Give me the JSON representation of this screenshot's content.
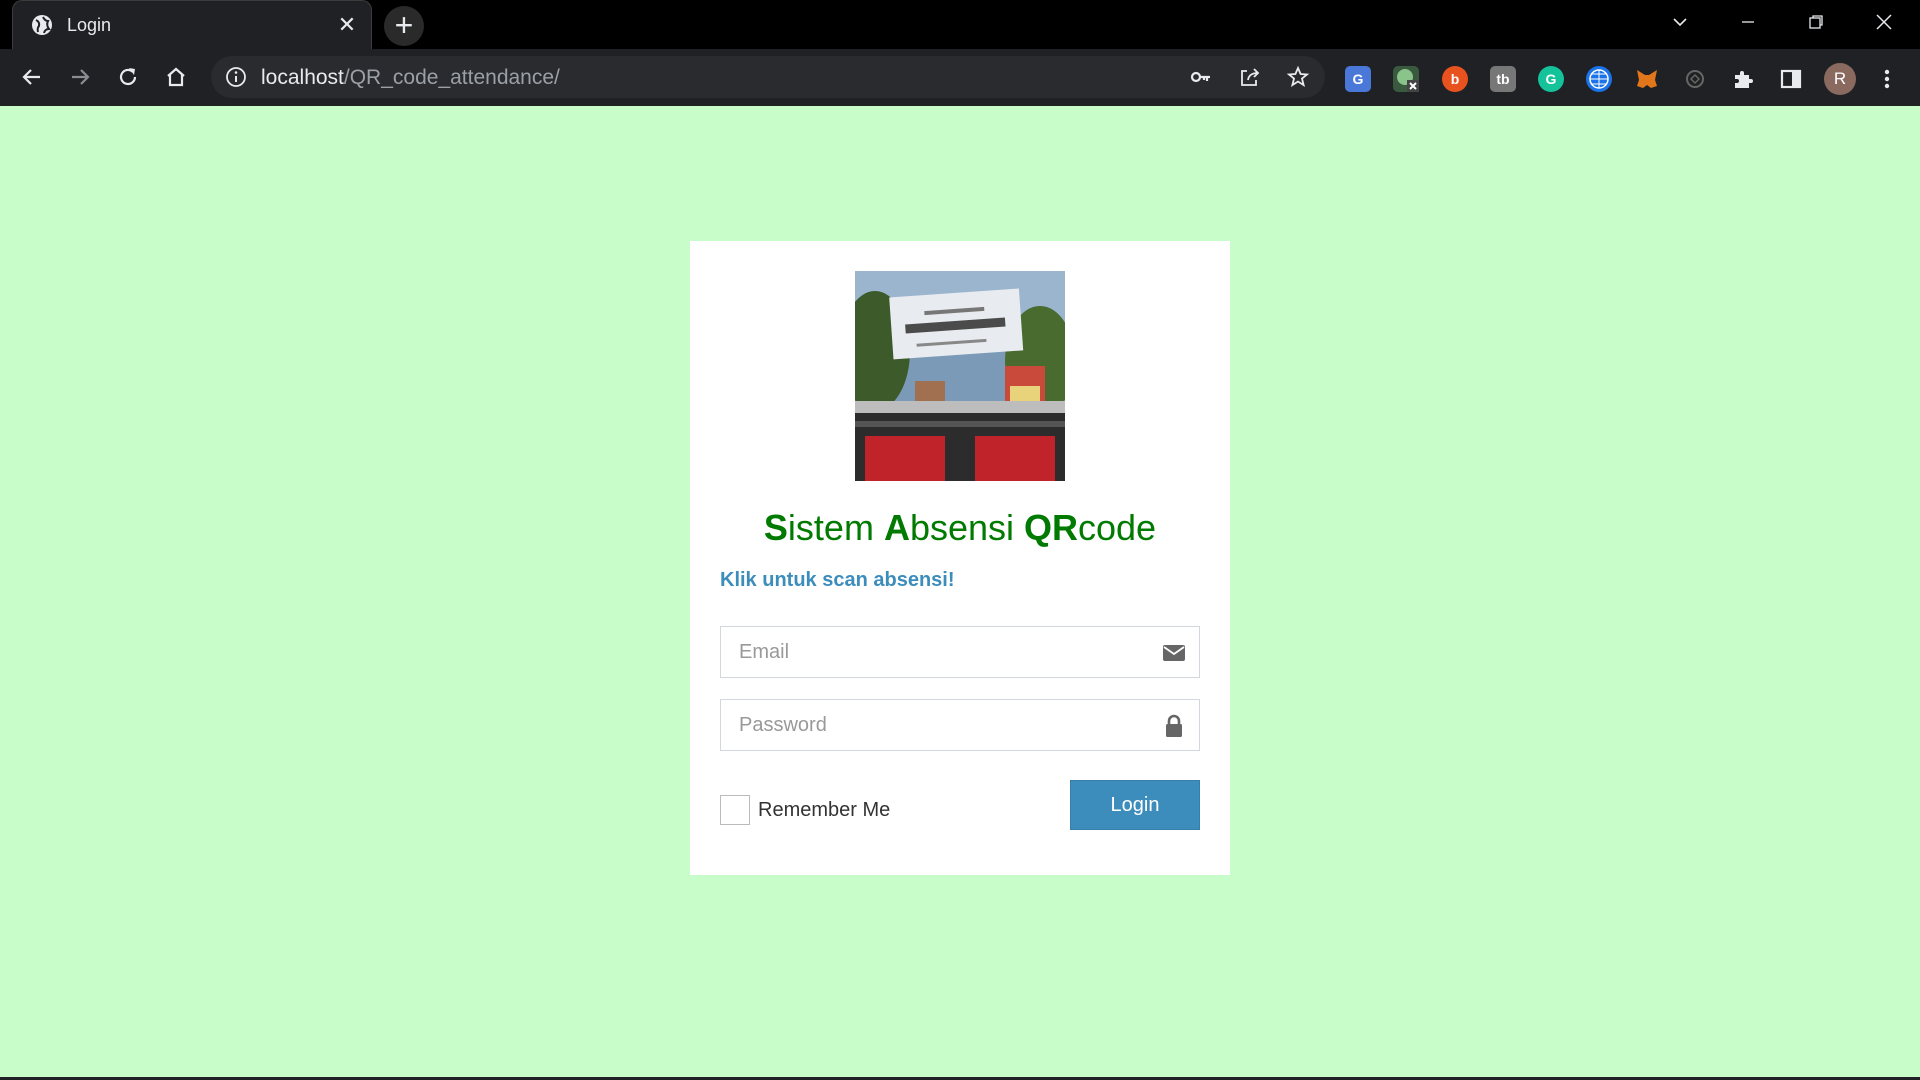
{
  "browser": {
    "tab_title": "Login",
    "new_tab_symbol": "+",
    "close_tab_symbol": "✕",
    "url_host": "localhost",
    "url_path": "/QR_code_attendance/",
    "profile_initial": "R",
    "icons": [
      "back-icon",
      "forward-icon",
      "reload-icon",
      "home-icon",
      "site-info-icon",
      "password-key-icon",
      "share-icon",
      "bookmark-star-icon",
      "extensions-puzzle-icon",
      "side-panel-icon",
      "menu-kebab-icon"
    ],
    "extensions": [
      "google-translate-icon",
      "extension-x-icon",
      "extension-red-icon",
      "extension-tb-icon",
      "grammarly-icon",
      "extension-globe-icon",
      "metamask-fox-icon",
      "extension-sync-icon"
    ]
  },
  "login": {
    "title_parts": [
      {
        "text": "S",
        "bold": true
      },
      {
        "text": "istem ",
        "bold": false
      },
      {
        "text": "A",
        "bold": true
      },
      {
        "text": "bsensi ",
        "bold": false
      },
      {
        "text": "QR",
        "bold": true
      },
      {
        "text": "code",
        "bold": false
      }
    ],
    "scan_link": "Klik untuk scan absensi!",
    "email_placeholder": "Email",
    "password_placeholder": "Password",
    "remember_label": "Remember Me",
    "login_button": "Login"
  },
  "colors": {
    "page_bg": "#c8fcc8",
    "title_green": "#007a00",
    "accent_blue": "#3c8dbc"
  }
}
